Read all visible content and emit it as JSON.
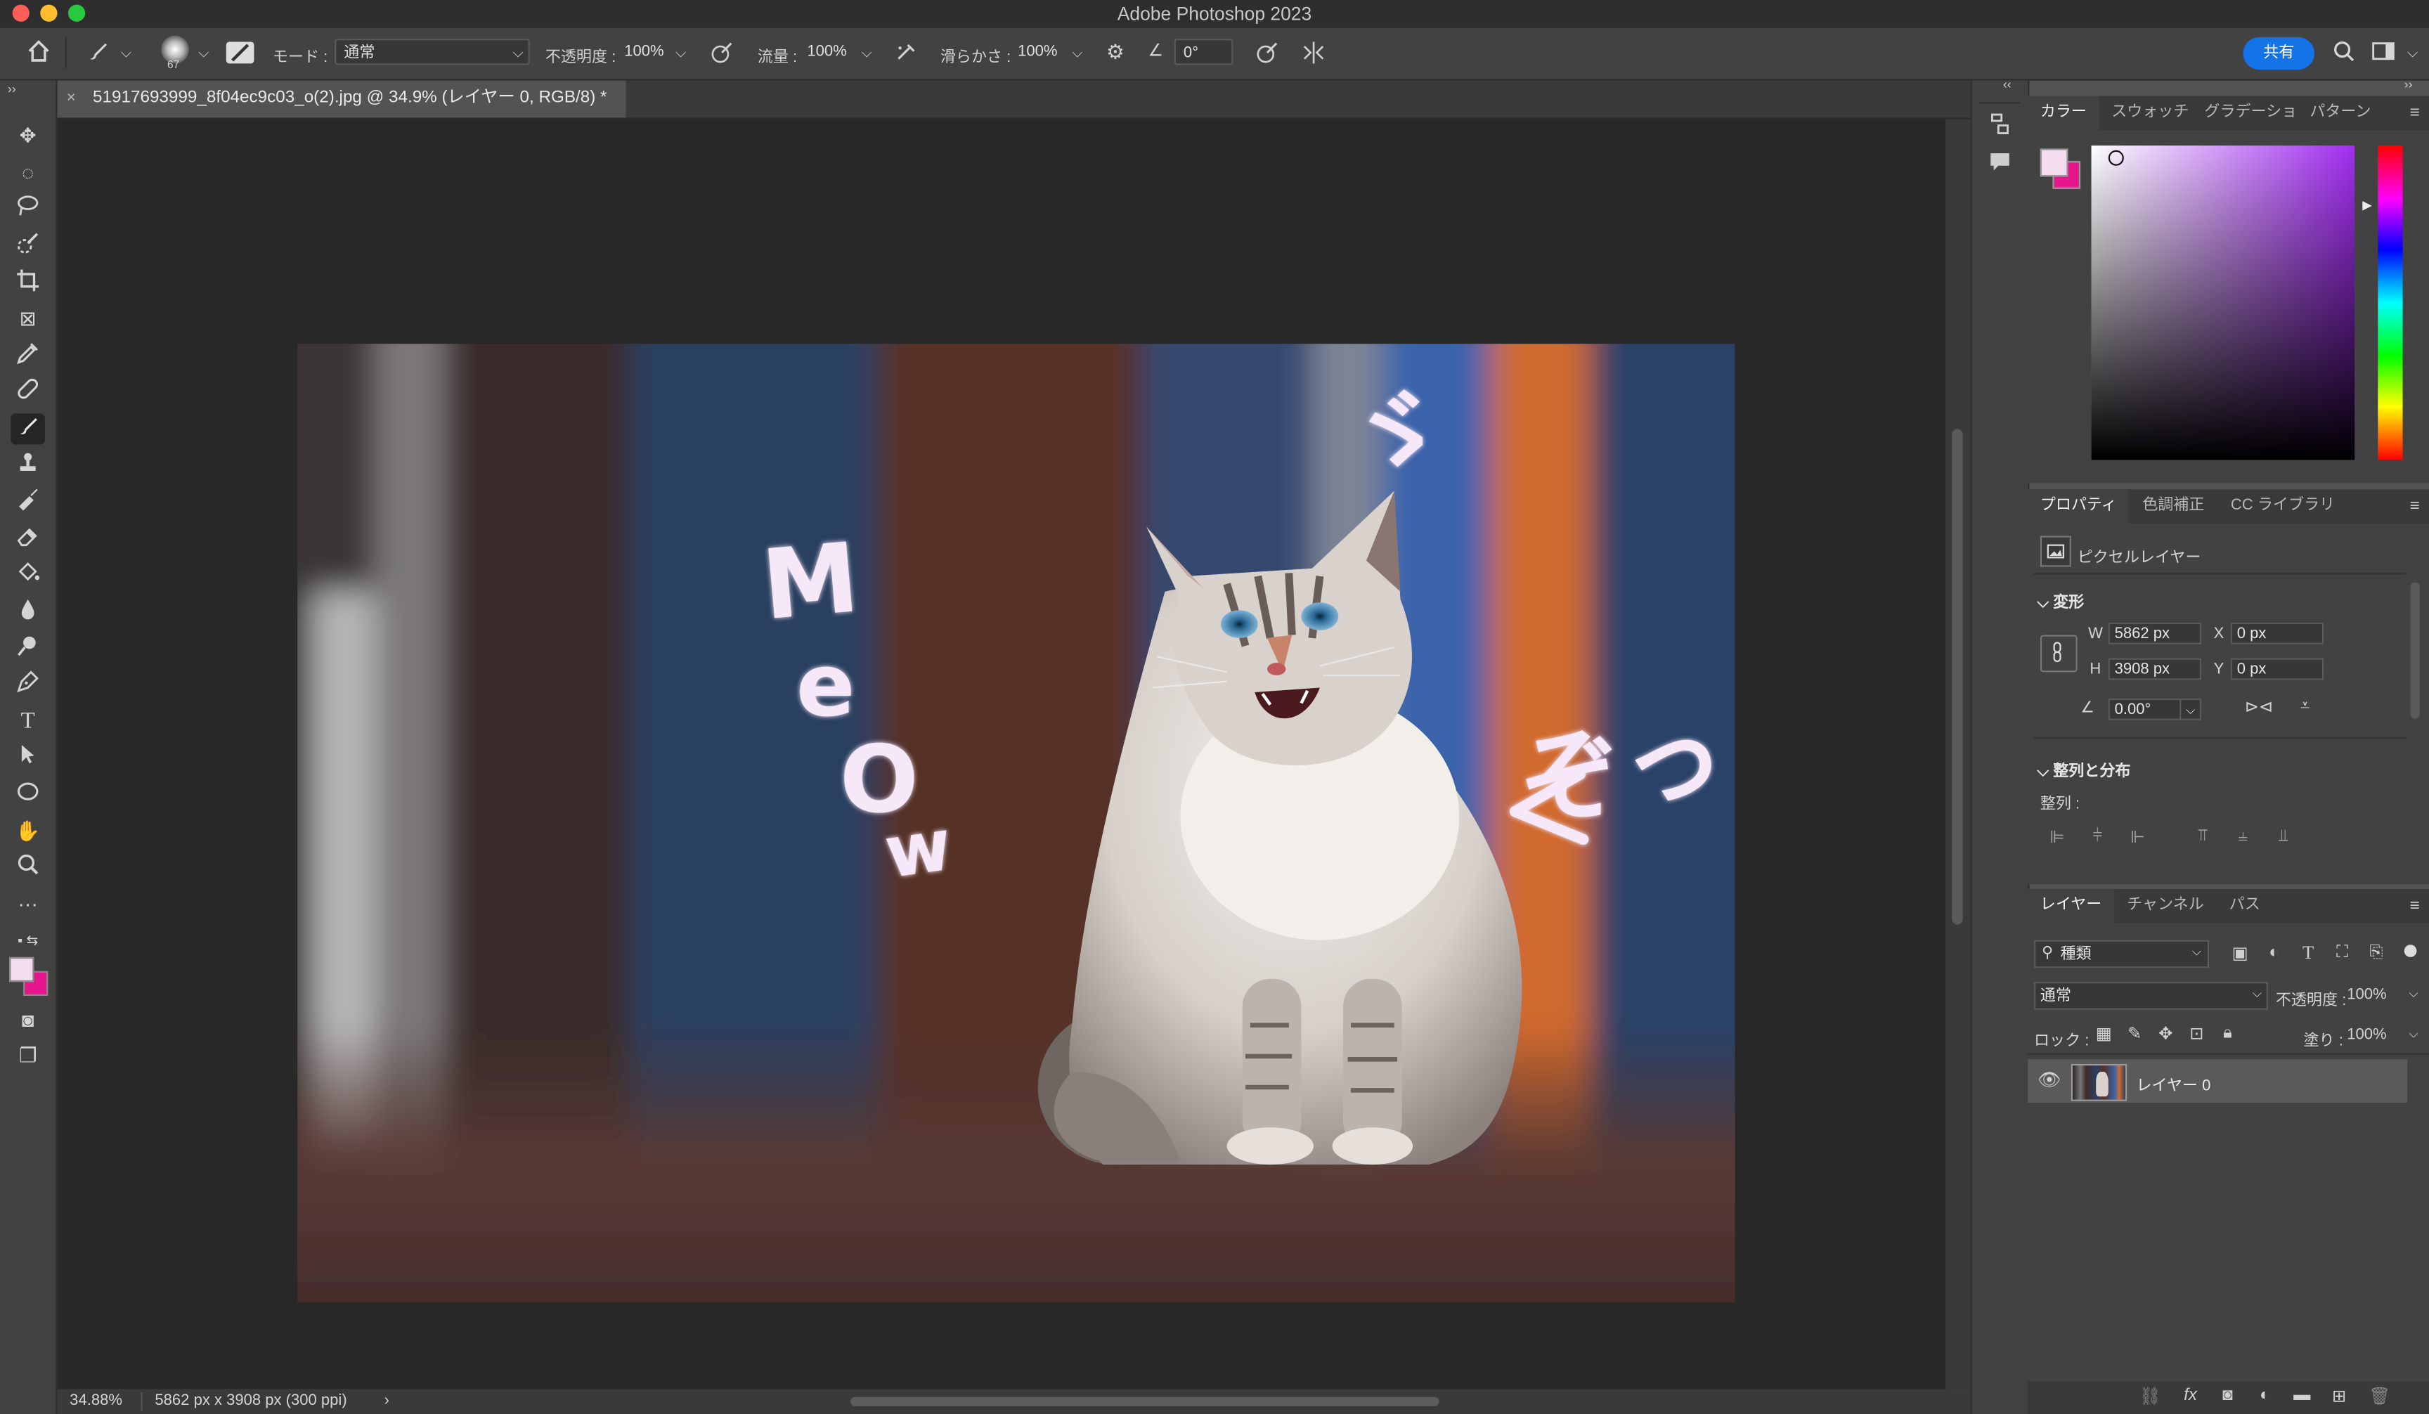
{
  "window": {
    "title": "Adobe Photoshop 2023"
  },
  "options_bar": {
    "brush_size": "67",
    "mode_label": "モード :",
    "mode_value": "通常",
    "opacity_label": "不透明度 :",
    "opacity_value": "100%",
    "flow_label": "流量 :",
    "flow_value": "100%",
    "smoothing_label": "滑らかさ :",
    "smoothing_value": "100%",
    "angle_value": "0°",
    "share_label": "共有"
  },
  "document": {
    "tab_label": "51917693999_8f04ec9c03_o(2).jpg @ 34.9% (レイヤー 0, RGB/8) *",
    "close_glyph": "×",
    "zoom_status": "34.88%",
    "size_status": "5862 px x 3908 px (300 ppi)",
    "status_arrow": "›",
    "canvas_text": {
      "meow": [
        "M",
        "e",
        "O",
        "w"
      ],
      "lines": "ゞ",
      "zo": "ぞっ"
    }
  },
  "color_panel": {
    "tabs": [
      "カラー",
      "スウォッチ",
      "グラデーショ",
      "パターン"
    ],
    "foreground": "#f2dcee",
    "background": "#e8168c"
  },
  "properties_panel": {
    "tabs": [
      "プロパティ",
      "色調補正",
      "CC ライブラリ"
    ],
    "layer_type": "ピクセルレイヤー",
    "transform_title": "変形",
    "w_label": "W",
    "w_value": "5862 px",
    "h_label": "H",
    "h_value": "3908 px",
    "x_label": "X",
    "x_value": "0 px",
    "y_label": "Y",
    "y_value": "0 px",
    "angle_value": "0.00°",
    "align_title": "整列と分布",
    "align_label": "整列 :"
  },
  "layers_panel": {
    "tabs": [
      "レイヤー",
      "チャンネル",
      "パス"
    ],
    "filter_kind": "種類",
    "blend_mode": "通常",
    "opacity_label": "不透明度 :",
    "opacity_value": "100%",
    "lock_label": "ロック :",
    "fill_label": "塗り :",
    "fill_value": "100%",
    "layers": [
      {
        "name": "レイヤー 0",
        "visible": true
      }
    ]
  },
  "icons": {
    "toolbar": [
      "move-icon",
      "marquee-icon",
      "lasso-icon",
      "quick-select-icon",
      "crop-icon",
      "frame-icon",
      "eyedropper-icon",
      "healing-icon",
      "brush-icon",
      "stamp-icon",
      "history-brush-icon",
      "eraser-icon",
      "bucket-icon",
      "blur-icon",
      "dodge-icon",
      "pen-icon",
      "type-icon",
      "path-select-icon",
      "ellipse-icon",
      "hand-icon",
      "zoom-icon",
      "more-icon"
    ]
  }
}
